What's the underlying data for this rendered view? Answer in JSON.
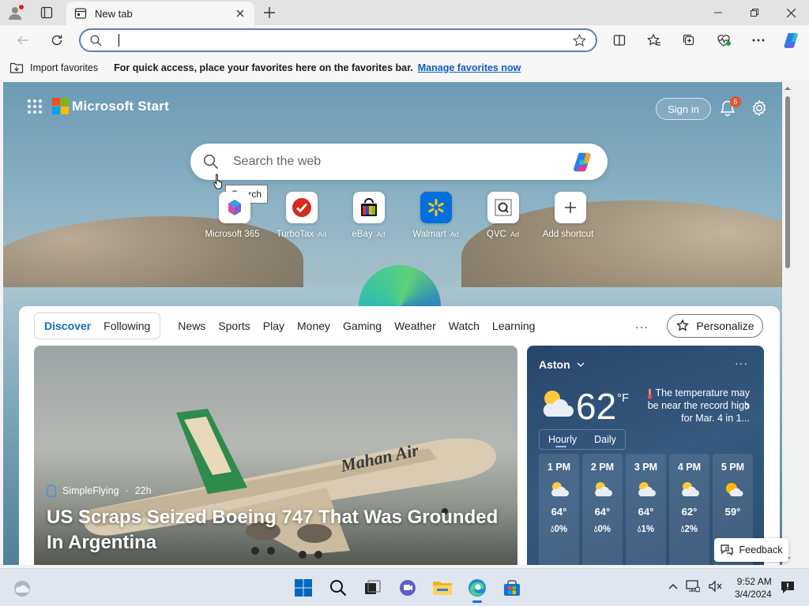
{
  "browser": {
    "tab_title": "New tab",
    "address_value": "",
    "favorites_bar": {
      "import_label": "Import favorites",
      "message": "For quick access, place your favorites here on the favorites bar.",
      "link": "Manage favorites now"
    }
  },
  "start": {
    "brand": "Microsoft Start",
    "sign_in": "Sign in",
    "notification_count": "6",
    "search_placeholder": "Search the web",
    "tooltip": "Search",
    "tiles": [
      {
        "label": "Microsoft 365",
        "ad": ""
      },
      {
        "label": "TurboTax",
        "ad": "Ad"
      },
      {
        "label": "eBay",
        "ad": "Ad"
      },
      {
        "label": "Walmart",
        "ad": "Ad"
      },
      {
        "label": "QVC",
        "ad": "Ad"
      },
      {
        "label": "Add shortcut",
        "ad": ""
      }
    ],
    "feed_tabs": {
      "primary": [
        "Discover",
        "Following"
      ],
      "categories": [
        "News",
        "Sports",
        "Play",
        "Money",
        "Gaming",
        "Weather",
        "Watch",
        "Learning"
      ],
      "more": "···",
      "personalize": "Personalize"
    },
    "hero": {
      "source": "SimpleFlying",
      "age": "22h",
      "title": "US Scraps Seized Boeing 747 That Was Grounded In Argentina"
    },
    "weather": {
      "location": "Aston",
      "temp": "62",
      "unit": "°F",
      "note": "The temperature may be near the record high for Mar. 4 in 1...",
      "tabs": [
        "Hourly",
        "Daily"
      ],
      "hours": [
        {
          "time": "1 PM",
          "temp": "64°",
          "precip": "0%",
          "icon": "partly-cloudy-icon"
        },
        {
          "time": "2 PM",
          "temp": "64°",
          "precip": "0%",
          "icon": "partly-cloudy-icon"
        },
        {
          "time": "3 PM",
          "temp": "64°",
          "precip": "1%",
          "icon": "partly-cloudy-icon"
        },
        {
          "time": "4 PM",
          "temp": "62°",
          "precip": "2%",
          "icon": "partly-cloudy-icon"
        },
        {
          "time": "5 PM",
          "temp": "59°",
          "precip": "",
          "icon": "sunny-cloudy-icon"
        }
      ]
    },
    "feedback": "Feedback"
  },
  "taskbar": {
    "time": "9:52 AM",
    "date": "3/4/2024"
  },
  "colors": {
    "accent": "#0f6cbd",
    "link": "#0f5cc0",
    "badge": "#e3542c"
  }
}
